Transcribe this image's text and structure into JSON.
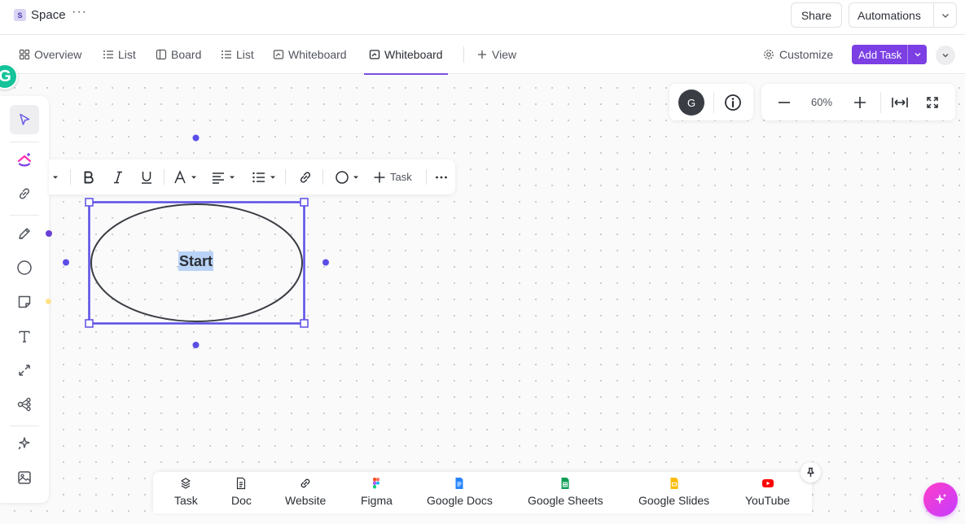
{
  "header": {
    "space_badge": "S",
    "space_name": "Space",
    "more": "···",
    "share_label": "Share",
    "automations_label": "Automations"
  },
  "tabs": [
    {
      "label": "Overview",
      "icon": "overview-icon"
    },
    {
      "label": "List",
      "icon": "list-icon"
    },
    {
      "label": "Board",
      "icon": "board-icon"
    },
    {
      "label": "List",
      "icon": "list-icon"
    },
    {
      "label": "Whiteboard",
      "icon": "whiteboard-icon"
    },
    {
      "label": "Whiteboard",
      "icon": "whiteboard-icon",
      "active": true
    },
    {
      "label": "View",
      "icon": "plus-icon"
    }
  ],
  "toolbar_right": {
    "customize_label": "Customize",
    "add_task_label": "Add Task"
  },
  "canvas": {
    "avatar_initial": "G",
    "grammarly_letter": "G",
    "zoom": "60%",
    "shape_text": "Start"
  },
  "format_bar": {
    "task_label": "Task"
  },
  "embeds": [
    {
      "label": "Task",
      "icon": "task-icon"
    },
    {
      "label": "Doc",
      "icon": "doc-icon"
    },
    {
      "label": "Website",
      "icon": "link-icon"
    },
    {
      "label": "Figma",
      "icon": "figma-icon"
    },
    {
      "label": "Google Docs",
      "icon": "google-docs-icon"
    },
    {
      "label": "Google Sheets",
      "icon": "google-sheets-icon"
    },
    {
      "label": "Google Slides",
      "icon": "google-slides-icon"
    },
    {
      "label": "YouTube",
      "icon": "youtube-icon"
    }
  ],
  "colors": {
    "accent": "#7b3fe4",
    "selection": "#5b4ee6",
    "text_highlight": "#b9d3f6"
  }
}
